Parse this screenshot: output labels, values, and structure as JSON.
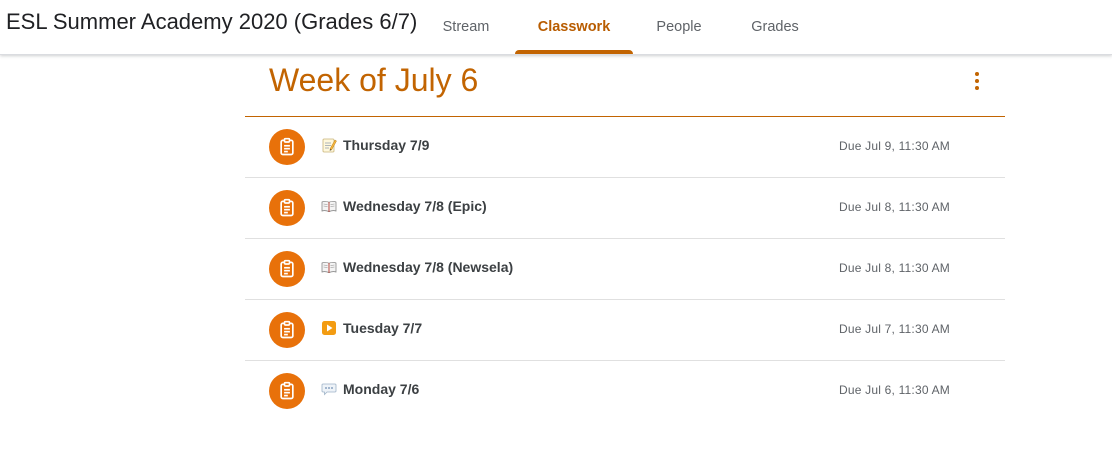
{
  "course": {
    "title": "ESL Summer Academy 2020 (Grades 6/7)"
  },
  "tabs": [
    {
      "label": "Stream",
      "active": false
    },
    {
      "label": "Classwork",
      "active": true
    },
    {
      "label": "People",
      "active": false
    },
    {
      "label": "Grades",
      "active": false
    }
  ],
  "topic": {
    "title": "Week of July 6",
    "menu_icon": "more-vert-icon",
    "items": [
      {
        "emoji": "memo",
        "title": "Thursday 7/9",
        "due": "Due Jul 9, 11:30 AM",
        "icon": "assignment-icon"
      },
      {
        "emoji": "open-book",
        "title": "Wednesday 7/8 (Epic)",
        "due": "Due Jul 8, 11:30 AM",
        "icon": "assignment-icon"
      },
      {
        "emoji": "open-book",
        "title": "Wednesday 7/8 (Newsela)",
        "due": "Due Jul 8, 11:30 AM",
        "icon": "assignment-icon"
      },
      {
        "emoji": "play-button",
        "title": "Tuesday 7/7",
        "due": "Due Jul 7, 11:30 AM",
        "icon": "assignment-icon"
      },
      {
        "emoji": "speech-balloon",
        "title": "Monday 7/6",
        "due": "Due Jul 6, 11:30 AM",
        "icon": "assignment-icon"
      }
    ]
  },
  "colors": {
    "accent": "#c26401",
    "assignment_icon_bg": "#e8710a",
    "tab_inactive": "#5f6368"
  }
}
